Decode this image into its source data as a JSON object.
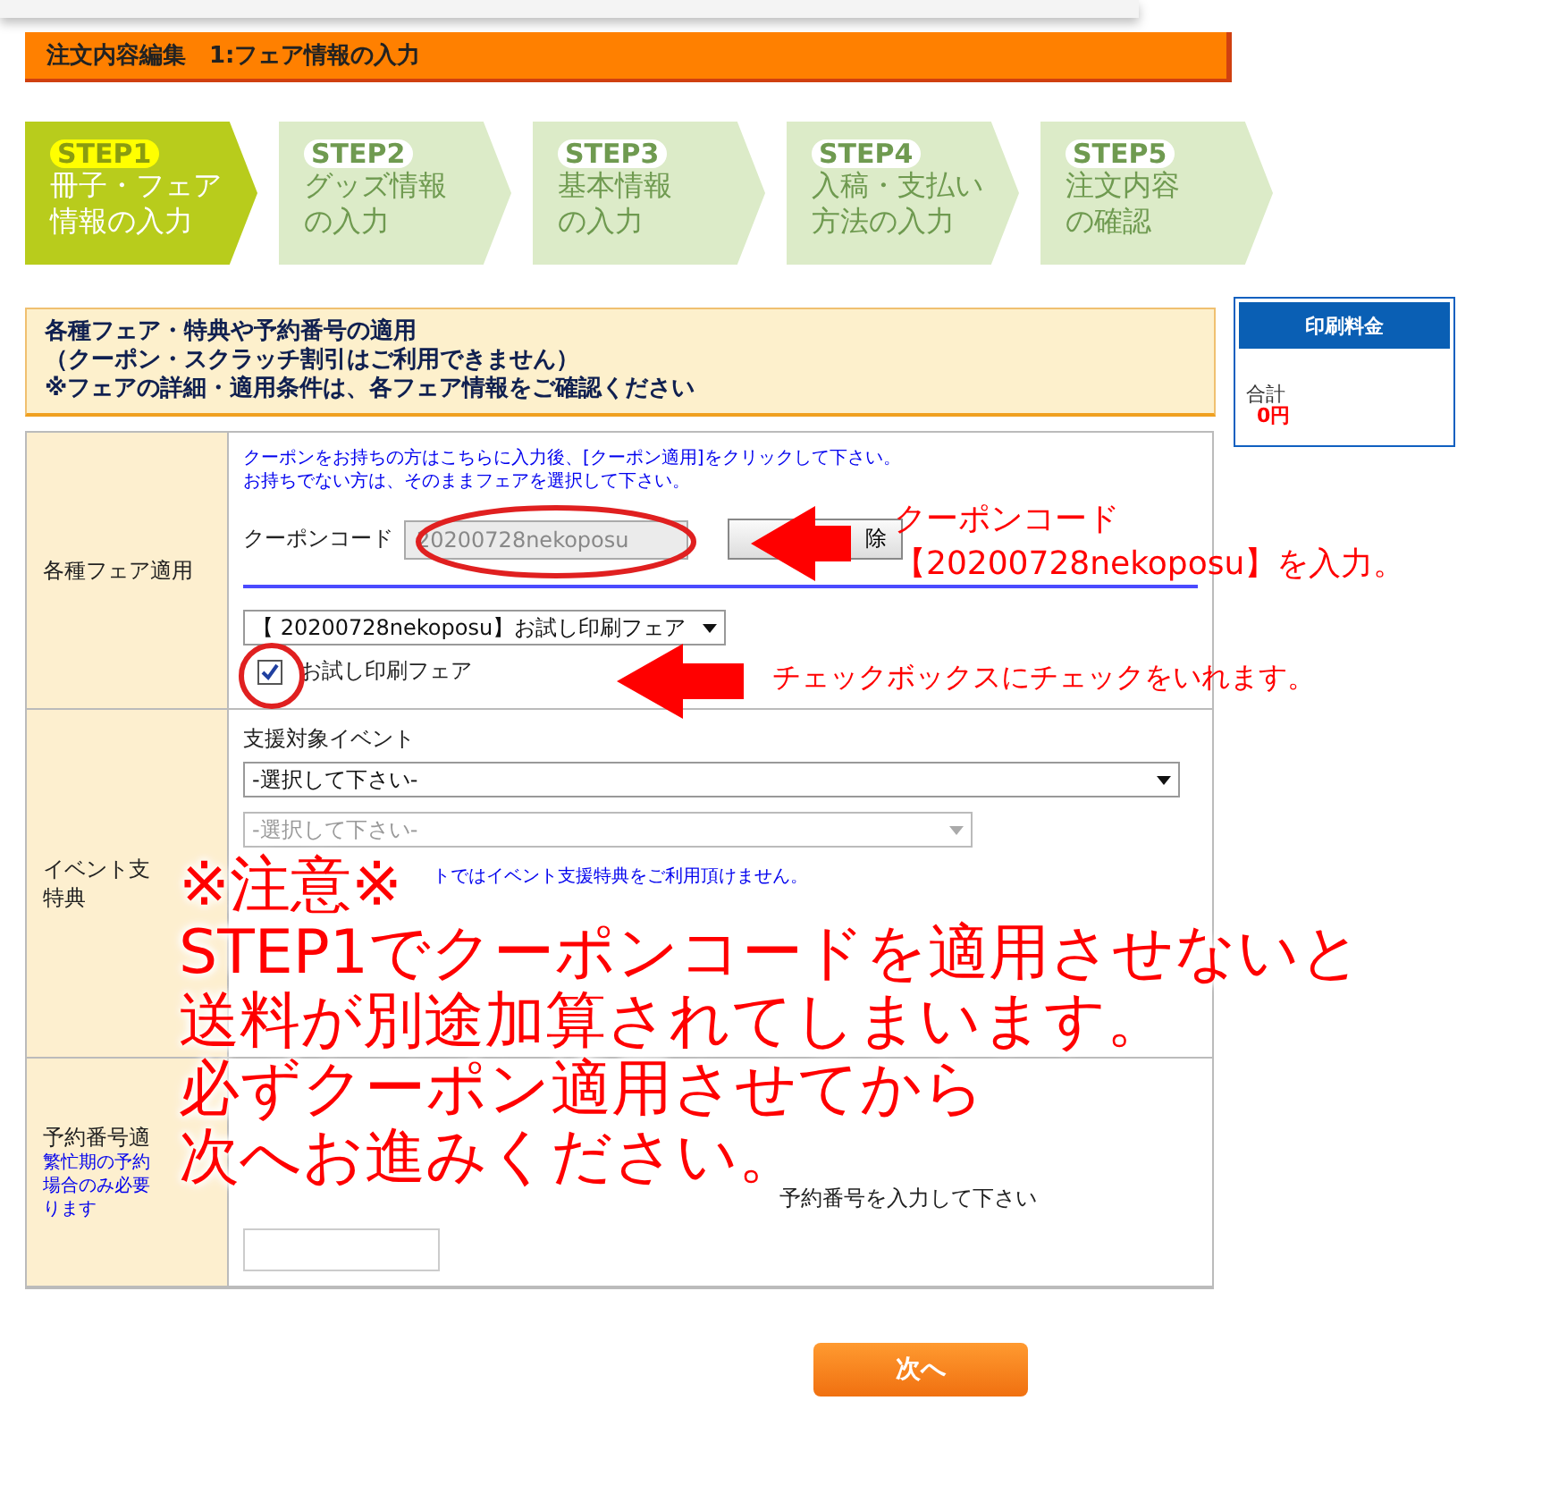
{
  "header": "注文内容編集　1:フェア情報の入力",
  "steps": [
    {
      "badge": "STEP1",
      "lines": [
        "冊子・フェア",
        "情報の入力"
      ],
      "selected": true
    },
    {
      "badge": "STEP2",
      "lines": [
        "グッズ情報",
        "の入力"
      ],
      "selected": false
    },
    {
      "badge": "STEP3",
      "lines": [
        "基本情報",
        "の入力"
      ],
      "selected": false
    },
    {
      "badge": "STEP4",
      "lines": [
        "入稿・支払い",
        "方法の入力"
      ],
      "selected": false
    },
    {
      "badge": "STEP5",
      "lines": [
        "注文内容",
        "の確認"
      ],
      "selected": false
    }
  ],
  "notice": [
    "各種フェア・特典や予約番号の適用",
    "（クーポン・スクラッチ割引はご利用できません）",
    "※フェアの詳細・適用条件は、各フェア情報をご確認ください"
  ],
  "price": {
    "title": "印刷料金",
    "total_label": "合計",
    "total": "0円"
  },
  "fair_row": {
    "label": "各種フェア適用",
    "hints": [
      "クーポンをお持ちの方はこちらに入力後、[クーポン適用]をクリックして下さい。",
      "お持ちでない方は、そのままフェアを選択して下さい。"
    ],
    "coupon_label": "クーポンコード",
    "coupon_value": "20200728nekoposu",
    "button_fragment": "除",
    "fair_select": "【 20200728nekoposu】お試し印刷フェア",
    "fair_checkbox": {
      "label": "お試し印刷フェア",
      "checked": true
    }
  },
  "event_row": {
    "label_lines": [
      "イベント支",
      "特典"
    ],
    "event_label": "支援対象イベント",
    "select_1": {
      "value": "-選択して下さい-",
      "disabled": false
    },
    "select_2": {
      "value": "-選択して下さい-",
      "disabled": true
    },
    "note": "トではイベント支援特典をご利用頂けません。"
  },
  "reservation_row": {
    "label": "予約番号適",
    "notes": [
      "繁忙期の予約",
      "場合のみ必要",
      "ります"
    ],
    "hint": "予約番号を入力して下さい"
  },
  "next_button": "次へ",
  "annotations": {
    "coupon_note": [
      "クーポンコード",
      "【20200728nekoposu】を入力。"
    ],
    "checkbox_note": "チェックボックスにチェックをいれます。",
    "warning": [
      "※注意※",
      "STEP1でクーポンコードを適用させないと",
      "送料が別途加算されてしまいます。",
      "必ずクーポン適用させてから",
      "次へお進みください。"
    ]
  }
}
